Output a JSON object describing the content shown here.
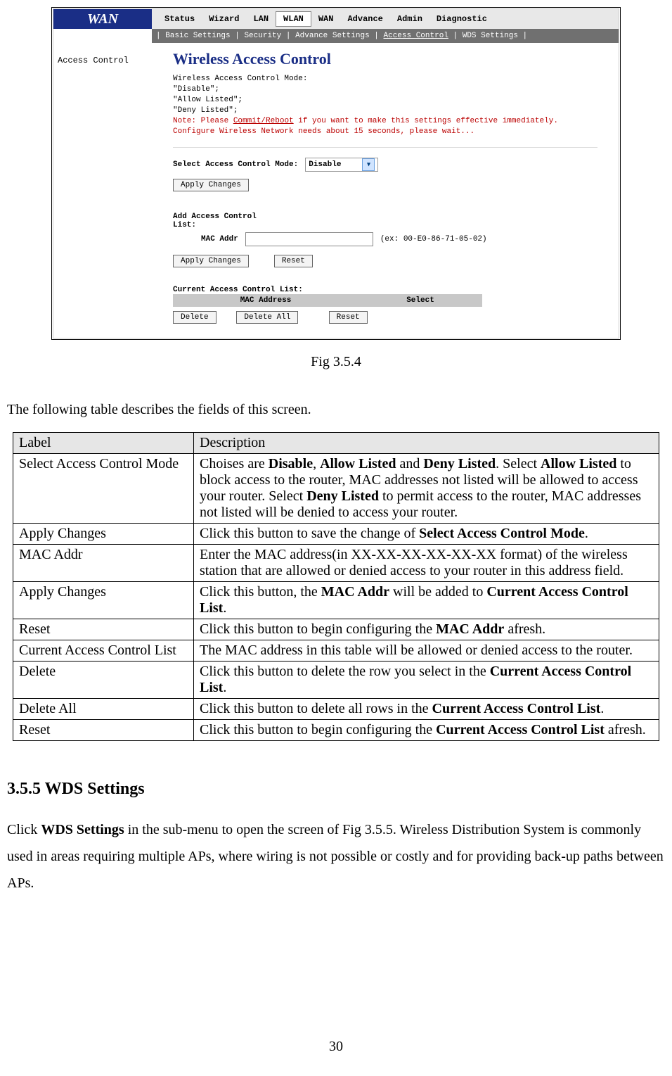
{
  "screenshot": {
    "brand": "WAN",
    "tabs": [
      "Status",
      "Wizard",
      "LAN",
      "WLAN",
      "WAN",
      "Advance",
      "Admin",
      "Diagnostic"
    ],
    "active_tab_index": 3,
    "submenu_items": [
      "Basic Settings",
      "Security",
      "Advance Settings",
      "Access Control",
      "WDS Settings"
    ],
    "submenu_active_index": 3,
    "sidebar_item": "Access Control",
    "content_title": "Wireless Access Control",
    "mode_intro_line1": "Wireless Access Control Mode:",
    "mode_intro_line2": "\"Disable\";",
    "mode_intro_line3": "\"Allow Listed\";",
    "mode_intro_line4": "\"Deny Listed\";",
    "note_part1": "Note: Please ",
    "note_link": "Commit/Reboot",
    "note_part2": " if you want to make this settings effective immediately.",
    "wait_note": "Configure Wireless Network needs about 15 seconds, please wait...",
    "select_label": "Select Access Control Mode:",
    "select_value": "Disable",
    "apply1": "Apply Changes",
    "add_list_label1": "Add Access Control",
    "add_list_label2": "List:",
    "mac_addr_label": "MAC Addr",
    "mac_addr_hint": "(ex: 00-E0-86-71-05-02)",
    "apply2": "Apply Changes",
    "reset1": "Reset",
    "current_list_label": "Current Access Control List:",
    "col1": "MAC Address",
    "col2": "Select",
    "delete": "Delete",
    "delete_all": "Delete All",
    "reset2": "Reset"
  },
  "fig_caption": "Fig 3.5.4",
  "intro_text": "The following table describes the fields of this screen.",
  "table_headers": {
    "label": "Label",
    "desc": "Description"
  },
  "rows": {
    "r0": {
      "label": "Select Access Control Mode"
    },
    "r0_desc": {
      "p1": "Choises are ",
      "b1": "Disable",
      "c1": ", ",
      "b2": "Allow Listed",
      "c2": " and ",
      "b3": "Deny Listed",
      "c3": ". Select ",
      "b4": "Allow Listed",
      "p2": " to block access to the router, MAC addresses not listed will be allowed to access your router. Select ",
      "b5": "Deny Listed",
      "p3": " to permit access to the router, MAC addresses not listed will be denied to access your router."
    },
    "r1": {
      "label": "Apply Changes"
    },
    "r1_desc": {
      "p1": "Click this button to save the change of ",
      "b1": "Select Access Control Mode",
      "p2": "."
    },
    "r2": {
      "label": "MAC Addr"
    },
    "r2_desc": {
      "p1": "Enter the MAC address(in XX-XX-XX-XX-XX-XX format) of the wireless station that are allowed or denied access to your router in this address field."
    },
    "r3": {
      "label": "Apply Changes"
    },
    "r3_desc": {
      "p1": "Click this button, the ",
      "b1": "MAC Addr",
      "p2": " will be added to ",
      "b2": "Current Access Control List",
      "p3": "."
    },
    "r4": {
      "label": "Reset"
    },
    "r4_desc": {
      "p1": "Click this button to begin configuring the ",
      "b1": "MAC Addr",
      "p2": " afresh."
    },
    "r5": {
      "label": "Current Access Control List"
    },
    "r5_desc": {
      "p1": "The MAC address in this table will be allowed or denied access to the router."
    },
    "r6": {
      "label": "Delete"
    },
    "r6_desc": {
      "p1": "Click this button to delete the row you select in the ",
      "b1": "Current Access Control List",
      "p2": "."
    },
    "r7": {
      "label": "Delete All"
    },
    "r7_desc": {
      "p1": "Click this button to delete all rows in the ",
      "b1": "Current Access Control List",
      "p2": "."
    },
    "r8": {
      "label": "Reset"
    },
    "r8_desc": {
      "p1": "Click this button to begin configuring the ",
      "b1": "Current Access Control List",
      "p2": " afresh."
    }
  },
  "section_title": "3.5.5 WDS Settings",
  "section_p1a": "Click ",
  "section_p1b": "WDS Settings",
  "section_p1c": " in the sub-menu to open the screen of Fig 3.5.5. Wireless Distribution System is commonly used in areas requiring multiple APs, where wiring is not possible or costly and for providing back-up paths between APs.",
  "page_number": "30"
}
